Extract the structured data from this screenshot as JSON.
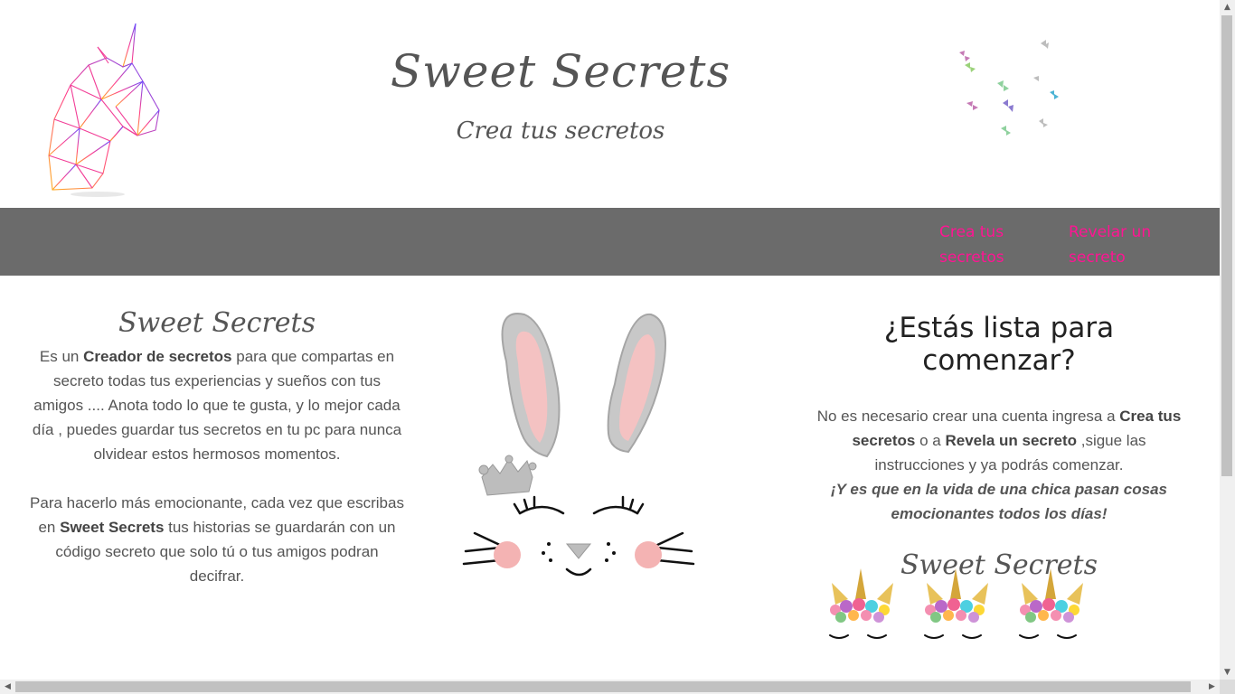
{
  "header": {
    "title": "Sweet Secrets",
    "subtitle": "Crea tus secretos"
  },
  "nav": {
    "links": [
      {
        "label_line1": "Crea tus",
        "label_line2": "secretos"
      },
      {
        "label_line1": "Revelar un",
        "label_line2": "secreto"
      }
    ]
  },
  "left": {
    "heading": "Sweet Secrets",
    "p1_a": "Es un ",
    "p1_b": "Creador de secretos",
    "p1_c": " para que compartas en secreto todas tus experiencias y sueños con tus amigos .... Anota todo lo que te gusta, y lo mejor cada día , puedes guardar tus secretos en tu pc para nunca olvidear estos hermosos momentos.",
    "p2_a": "Para hacerlo más emocionante, cada vez que escribas en ",
    "p2_b": "Sweet Secrets",
    "p2_c": " tus historias se guardarán con un código secreto que solo tú o tus amigos podran decifrar."
  },
  "right": {
    "title": "¿Estás lista para comenzar?",
    "p_a": "No es necesario crear una cuenta ingresa a ",
    "p_b": "Crea tus secretos",
    "p_c": " o a ",
    "p_d": "Revela un secreto",
    "p_e": " ,sigue las instrucciones y ya podrás comenzar.",
    "emphasis": "¡Y es que en la vida de una chica pasan cosas emocionantes todos los días!",
    "script": "Sweet Secrets"
  },
  "colors": {
    "nav_bg": "#6b6b6b",
    "nav_link": "#ff1493",
    "text": "#555555"
  },
  "icons": [
    "unicorn-logo-icon",
    "butterflies-icon",
    "bunny-face-icon",
    "unicorn-flower-crown-icon"
  ]
}
